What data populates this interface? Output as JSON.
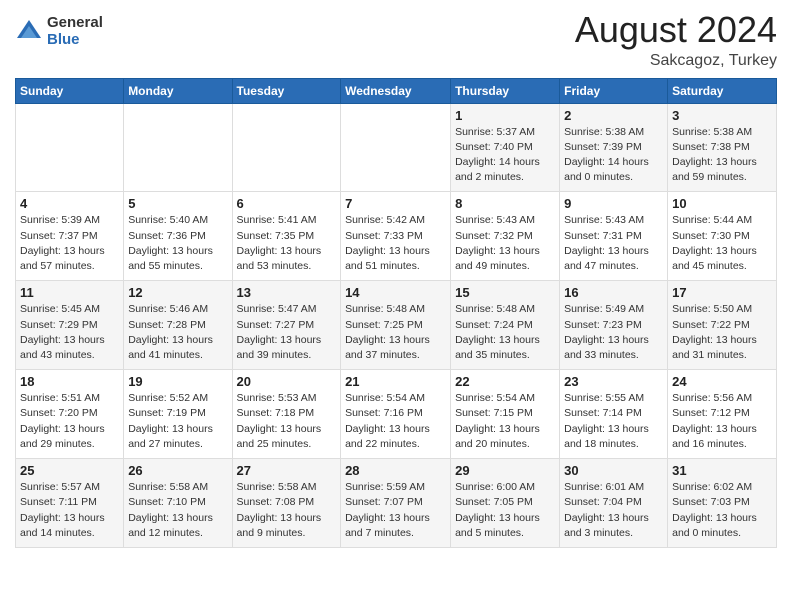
{
  "header": {
    "logo_general": "General",
    "logo_blue": "Blue",
    "title": "August 2024",
    "subtitle": "Sakcagoz, Turkey"
  },
  "weekdays": [
    "Sunday",
    "Monday",
    "Tuesday",
    "Wednesday",
    "Thursday",
    "Friday",
    "Saturday"
  ],
  "weeks": [
    [
      {
        "day": "",
        "sunrise": "",
        "sunset": "",
        "daylight": ""
      },
      {
        "day": "",
        "sunrise": "",
        "sunset": "",
        "daylight": ""
      },
      {
        "day": "",
        "sunrise": "",
        "sunset": "",
        "daylight": ""
      },
      {
        "day": "",
        "sunrise": "",
        "sunset": "",
        "daylight": ""
      },
      {
        "day": "1",
        "sunrise": "Sunrise: 5:37 AM",
        "sunset": "Sunset: 7:40 PM",
        "daylight": "Daylight: 14 hours and 2 minutes."
      },
      {
        "day": "2",
        "sunrise": "Sunrise: 5:38 AM",
        "sunset": "Sunset: 7:39 PM",
        "daylight": "Daylight: 14 hours and 0 minutes."
      },
      {
        "day": "3",
        "sunrise": "Sunrise: 5:38 AM",
        "sunset": "Sunset: 7:38 PM",
        "daylight": "Daylight: 13 hours and 59 minutes."
      }
    ],
    [
      {
        "day": "4",
        "sunrise": "Sunrise: 5:39 AM",
        "sunset": "Sunset: 7:37 PM",
        "daylight": "Daylight: 13 hours and 57 minutes."
      },
      {
        "day": "5",
        "sunrise": "Sunrise: 5:40 AM",
        "sunset": "Sunset: 7:36 PM",
        "daylight": "Daylight: 13 hours and 55 minutes."
      },
      {
        "day": "6",
        "sunrise": "Sunrise: 5:41 AM",
        "sunset": "Sunset: 7:35 PM",
        "daylight": "Daylight: 13 hours and 53 minutes."
      },
      {
        "day": "7",
        "sunrise": "Sunrise: 5:42 AM",
        "sunset": "Sunset: 7:33 PM",
        "daylight": "Daylight: 13 hours and 51 minutes."
      },
      {
        "day": "8",
        "sunrise": "Sunrise: 5:43 AM",
        "sunset": "Sunset: 7:32 PM",
        "daylight": "Daylight: 13 hours and 49 minutes."
      },
      {
        "day": "9",
        "sunrise": "Sunrise: 5:43 AM",
        "sunset": "Sunset: 7:31 PM",
        "daylight": "Daylight: 13 hours and 47 minutes."
      },
      {
        "day": "10",
        "sunrise": "Sunrise: 5:44 AM",
        "sunset": "Sunset: 7:30 PM",
        "daylight": "Daylight: 13 hours and 45 minutes."
      }
    ],
    [
      {
        "day": "11",
        "sunrise": "Sunrise: 5:45 AM",
        "sunset": "Sunset: 7:29 PM",
        "daylight": "Daylight: 13 hours and 43 minutes."
      },
      {
        "day": "12",
        "sunrise": "Sunrise: 5:46 AM",
        "sunset": "Sunset: 7:28 PM",
        "daylight": "Daylight: 13 hours and 41 minutes."
      },
      {
        "day": "13",
        "sunrise": "Sunrise: 5:47 AM",
        "sunset": "Sunset: 7:27 PM",
        "daylight": "Daylight: 13 hours and 39 minutes."
      },
      {
        "day": "14",
        "sunrise": "Sunrise: 5:48 AM",
        "sunset": "Sunset: 7:25 PM",
        "daylight": "Daylight: 13 hours and 37 minutes."
      },
      {
        "day": "15",
        "sunrise": "Sunrise: 5:48 AM",
        "sunset": "Sunset: 7:24 PM",
        "daylight": "Daylight: 13 hours and 35 minutes."
      },
      {
        "day": "16",
        "sunrise": "Sunrise: 5:49 AM",
        "sunset": "Sunset: 7:23 PM",
        "daylight": "Daylight: 13 hours and 33 minutes."
      },
      {
        "day": "17",
        "sunrise": "Sunrise: 5:50 AM",
        "sunset": "Sunset: 7:22 PM",
        "daylight": "Daylight: 13 hours and 31 minutes."
      }
    ],
    [
      {
        "day": "18",
        "sunrise": "Sunrise: 5:51 AM",
        "sunset": "Sunset: 7:20 PM",
        "daylight": "Daylight: 13 hours and 29 minutes."
      },
      {
        "day": "19",
        "sunrise": "Sunrise: 5:52 AM",
        "sunset": "Sunset: 7:19 PM",
        "daylight": "Daylight: 13 hours and 27 minutes."
      },
      {
        "day": "20",
        "sunrise": "Sunrise: 5:53 AM",
        "sunset": "Sunset: 7:18 PM",
        "daylight": "Daylight: 13 hours and 25 minutes."
      },
      {
        "day": "21",
        "sunrise": "Sunrise: 5:54 AM",
        "sunset": "Sunset: 7:16 PM",
        "daylight": "Daylight: 13 hours and 22 minutes."
      },
      {
        "day": "22",
        "sunrise": "Sunrise: 5:54 AM",
        "sunset": "Sunset: 7:15 PM",
        "daylight": "Daylight: 13 hours and 20 minutes."
      },
      {
        "day": "23",
        "sunrise": "Sunrise: 5:55 AM",
        "sunset": "Sunset: 7:14 PM",
        "daylight": "Daylight: 13 hours and 18 minutes."
      },
      {
        "day": "24",
        "sunrise": "Sunrise: 5:56 AM",
        "sunset": "Sunset: 7:12 PM",
        "daylight": "Daylight: 13 hours and 16 minutes."
      }
    ],
    [
      {
        "day": "25",
        "sunrise": "Sunrise: 5:57 AM",
        "sunset": "Sunset: 7:11 PM",
        "daylight": "Daylight: 13 hours and 14 minutes."
      },
      {
        "day": "26",
        "sunrise": "Sunrise: 5:58 AM",
        "sunset": "Sunset: 7:10 PM",
        "daylight": "Daylight: 13 hours and 12 minutes."
      },
      {
        "day": "27",
        "sunrise": "Sunrise: 5:58 AM",
        "sunset": "Sunset: 7:08 PM",
        "daylight": "Daylight: 13 hours and 9 minutes."
      },
      {
        "day": "28",
        "sunrise": "Sunrise: 5:59 AM",
        "sunset": "Sunset: 7:07 PM",
        "daylight": "Daylight: 13 hours and 7 minutes."
      },
      {
        "day": "29",
        "sunrise": "Sunrise: 6:00 AM",
        "sunset": "Sunset: 7:05 PM",
        "daylight": "Daylight: 13 hours and 5 minutes."
      },
      {
        "day": "30",
        "sunrise": "Sunrise: 6:01 AM",
        "sunset": "Sunset: 7:04 PM",
        "daylight": "Daylight: 13 hours and 3 minutes."
      },
      {
        "day": "31",
        "sunrise": "Sunrise: 6:02 AM",
        "sunset": "Sunset: 7:03 PM",
        "daylight": "Daylight: 13 hours and 0 minutes."
      }
    ]
  ]
}
